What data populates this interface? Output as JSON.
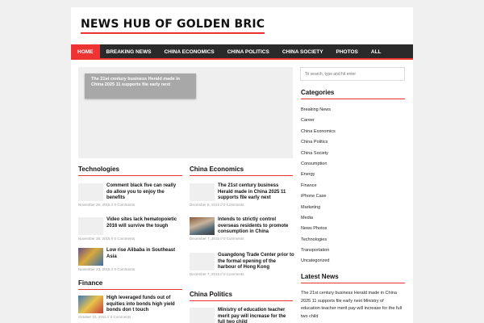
{
  "site": {
    "title": "NEWS HUB OF GOLDEN BRIC"
  },
  "nav": [
    "HOME",
    "BREAKING NEWS",
    "CHINA ECONOMICS",
    "CHINA POLITICS",
    "CHINA SOCIETY",
    "PHOTOS",
    "ALL"
  ],
  "slider": {
    "caption": "The 21st century business Herald made in China 2025 11 supports file early next"
  },
  "technologies": {
    "title": "Technologies",
    "items": [
      {
        "title": "Comment black five can really do allow you to enjoy the benefits",
        "meta": "November 26, 2015 // 0 Comments"
      },
      {
        "title": "Video sites lack hematopoietic 2016 will survive the tough",
        "meta": "November 26, 2015 // 0 Comments"
      },
      {
        "title": "Low rise Alibaba in Southeast Asia",
        "meta": "November 23, 2015 // 0 Comments"
      }
    ]
  },
  "finance": {
    "title": "Finance",
    "items": [
      {
        "title": "High leveraged funds out of equities into bonds high yield bonds don t touch",
        "meta": "October 10, 2015 // 0 Comments"
      }
    ]
  },
  "china_economics": {
    "title": "China Economics",
    "items": [
      {
        "title": "The 21st century business Herald made in China 2025 11 supports file early next",
        "meta": "December 8, 2015 // 0 Comments"
      },
      {
        "title": "Intends to strictly control overseas residents to promote consumption in China",
        "meta": "December 7, 2015 // 0 Comments"
      },
      {
        "title": "Guangdong Trade Center prior to the formal opening of the harbour of Hong Kong",
        "meta": "December 7, 2015 // 0 Comments"
      }
    ]
  },
  "china_politics": {
    "title": "China Politics",
    "items": [
      {
        "title": "Ministry of education teacher merit pay will increase for the full two child",
        "meta": ""
      }
    ]
  },
  "search": {
    "placeholder": "To search, type and hit enter"
  },
  "categories": {
    "title": "Categories",
    "items": [
      "Breaking News",
      "Career",
      "China Economics",
      "China Politics",
      "China Society",
      "Consumption",
      "Energy",
      "Finance",
      "iPhone Case",
      "Marketing",
      "Media",
      "News Photos",
      "Technologies",
      "Transportation",
      "Uncategorized"
    ]
  },
  "latest": {
    "title": "Latest News",
    "text": "The 21st century business Herald made in China 2025 11 supports file early next Ministry of education teacher merit pay will increase for the full two child"
  },
  "colors": {
    "accent": "#e33333",
    "nav_bg": "#2a2a2a"
  }
}
